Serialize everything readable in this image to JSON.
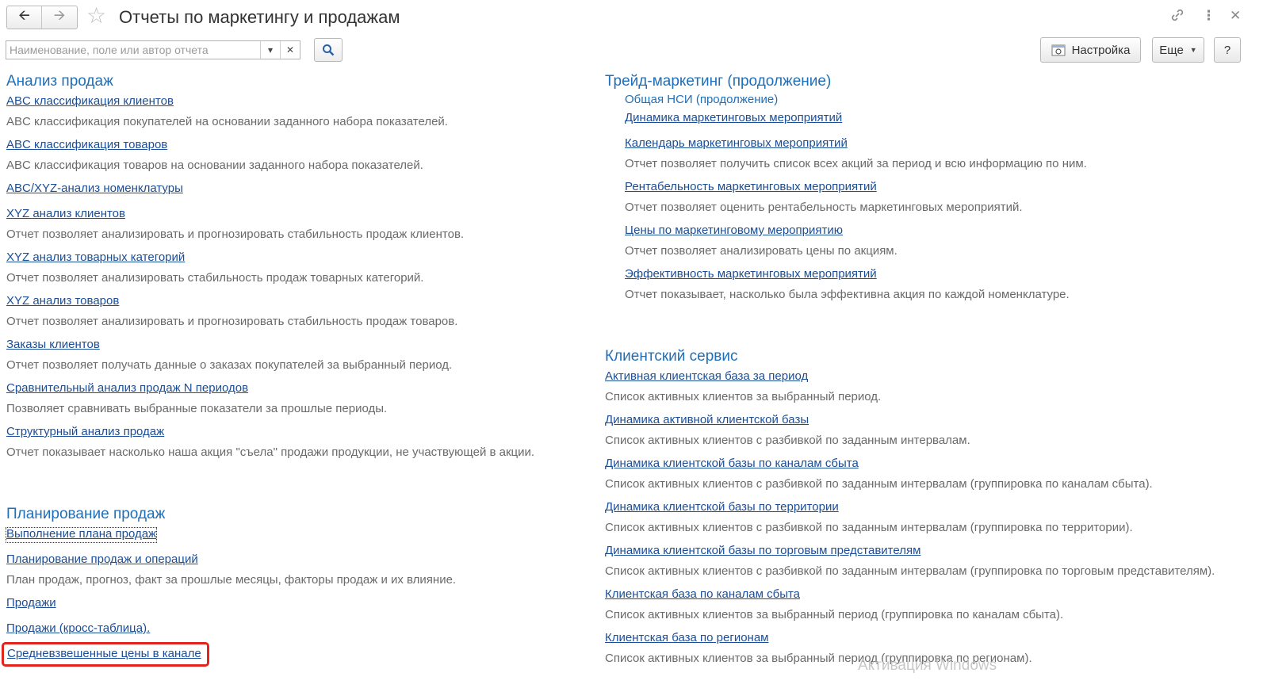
{
  "header": {
    "title": "Отчеты по маркетингу и продажам"
  },
  "search": {
    "placeholder": "Наименование, поле или автор отчета",
    "value": ""
  },
  "toolbar": {
    "settings_label": "Настройка",
    "more_label": "Еще",
    "help_label": "?"
  },
  "sales_analysis": {
    "title": "Анализ продаж",
    "items": [
      {
        "name": "ABC классификация клиентов",
        "desc": "ABC классификация покупателей на основании заданного набора показателей."
      },
      {
        "name": "ABC классификация товаров",
        "desc": "ABC классификация товаров на основании заданного набора показателей."
      },
      {
        "name": "ABC/XYZ-анализ номенклатуры",
        "desc": ""
      },
      {
        "name": "XYZ анализ клиентов",
        "desc": "Отчет позволяет анализировать и прогнозировать стабильность продаж клиентов."
      },
      {
        "name": "XYZ анализ товарных категорий",
        "desc": "Отчет позволяет анализировать стабильность продаж товарных категорий."
      },
      {
        "name": "XYZ анализ товаров",
        "desc": "Отчет позволяет анализировать и прогнозировать стабильность продаж товаров."
      },
      {
        "name": "Заказы клиентов",
        "desc": "Отчет позволяет получать данные о заказах покупателей за выбранный период."
      },
      {
        "name": "Сравнительный анализ продаж N периодов",
        "desc": "Позволяет сравнивать выбранные показатели за прошлые периоды."
      },
      {
        "name": "Структурный анализ продаж",
        "desc": "Отчет показывает насколько наша акция \"съела\" продажи продукции, не участвующей в акции."
      }
    ]
  },
  "sales_planning": {
    "title": "Планирование продаж",
    "items": [
      {
        "name": "Выполнение плана продаж",
        "desc": ""
      },
      {
        "name": "Планирование продаж и операций",
        "desc": "План продаж, прогноз, факт за прошлые месяцы, факторы продаж и их влияние."
      },
      {
        "name": "Продажи",
        "desc": ""
      },
      {
        "name": "Продажи (кросс-таблица).",
        "desc": ""
      },
      {
        "name": "Средневзвешенные цены в канале",
        "desc": ""
      }
    ]
  },
  "trade_marketing": {
    "title": "Трейд-маркетинг (продолжение)",
    "subgroup": "Общая НСИ (продолжение)",
    "items": [
      {
        "name": "Динамика маркетинговых мероприятий",
        "desc": ""
      },
      {
        "name": "Календарь маркетинговых мероприятий",
        "desc": "Отчет позволяет получить список всех акций за период и всю информацию по ним."
      },
      {
        "name": "Рентабельность маркетинговых мероприятий",
        "desc": "Отчет позволяет оценить рентабельность маркетинговых мероприятий."
      },
      {
        "name": "Цены по маркетинговому мероприятию",
        "desc": "Отчет позволяет анализировать цены по акциям."
      },
      {
        "name": "Эффективность маркетинговых мероприятий",
        "desc": "Отчет показывает, насколько была эффективна акция по каждой номенклатуре."
      }
    ]
  },
  "client_service": {
    "title": "Клиентский сервис",
    "items": [
      {
        "name": "Активная клиентская база за период",
        "desc": "Список активных клиентов за выбранный период."
      },
      {
        "name": "Динамика активной клиентской базы",
        "desc": "Список активных клиентов с разбивкой по заданным интервалам."
      },
      {
        "name": "Динамика клиентской базы по каналам сбыта",
        "desc": "Список активных клиентов с разбивкой по заданным интервалам (группировка по каналам сбыта)."
      },
      {
        "name": "Динамика клиентской базы по территории",
        "desc": "Список активных клиентов с разбивкой по заданным интервалам (группировка по территории)."
      },
      {
        "name": "Динамика клиентской базы по торговым представителям",
        "desc": "Список активных клиентов с разбивкой по заданным интервалам (группировка по торговым представителям)."
      },
      {
        "name": "Клиентская база по каналам сбыта",
        "desc": "Список активных клиентов за выбранный период (группировка по каналам сбыта)."
      },
      {
        "name": "Клиентская база по регионам",
        "desc": "Список активных клиентов за выбранный период (группировка по регионам)."
      }
    ]
  },
  "watermark": "Активация Windows"
}
